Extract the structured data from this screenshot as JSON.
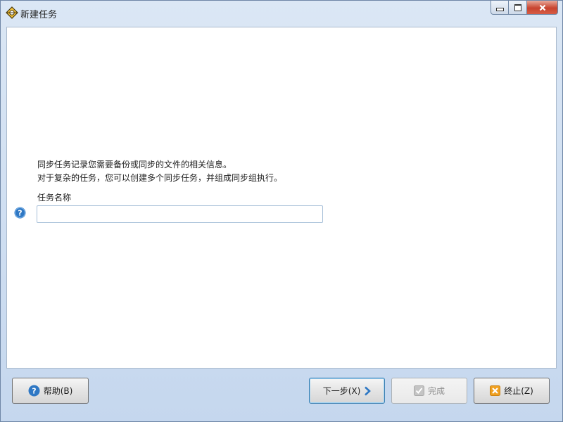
{
  "window": {
    "title": "新建任务"
  },
  "content": {
    "description_line1": "同步任务记录您需要备份或同步的文件的相关信息。",
    "description_line2": "对于复杂的任务，您可以创建多个同步任务，并组成同步组执行。",
    "task_name_label": "任务名称",
    "task_name_value": "",
    "task_name_placeholder": ""
  },
  "buttons": {
    "help_label": "帮助(B)",
    "next_label": "下一步(X)",
    "finish_label": "完成",
    "stop_label": "终止(Z)"
  },
  "icons": {
    "app": "app-icon",
    "help": "help-icon",
    "next": "chevron-right-icon",
    "finish": "checkmark-icon",
    "stop": "close-icon"
  },
  "colors": {
    "accent_blue": "#2f78c4",
    "stop_orange": "#f0a020",
    "close_red": "#c7432e"
  }
}
